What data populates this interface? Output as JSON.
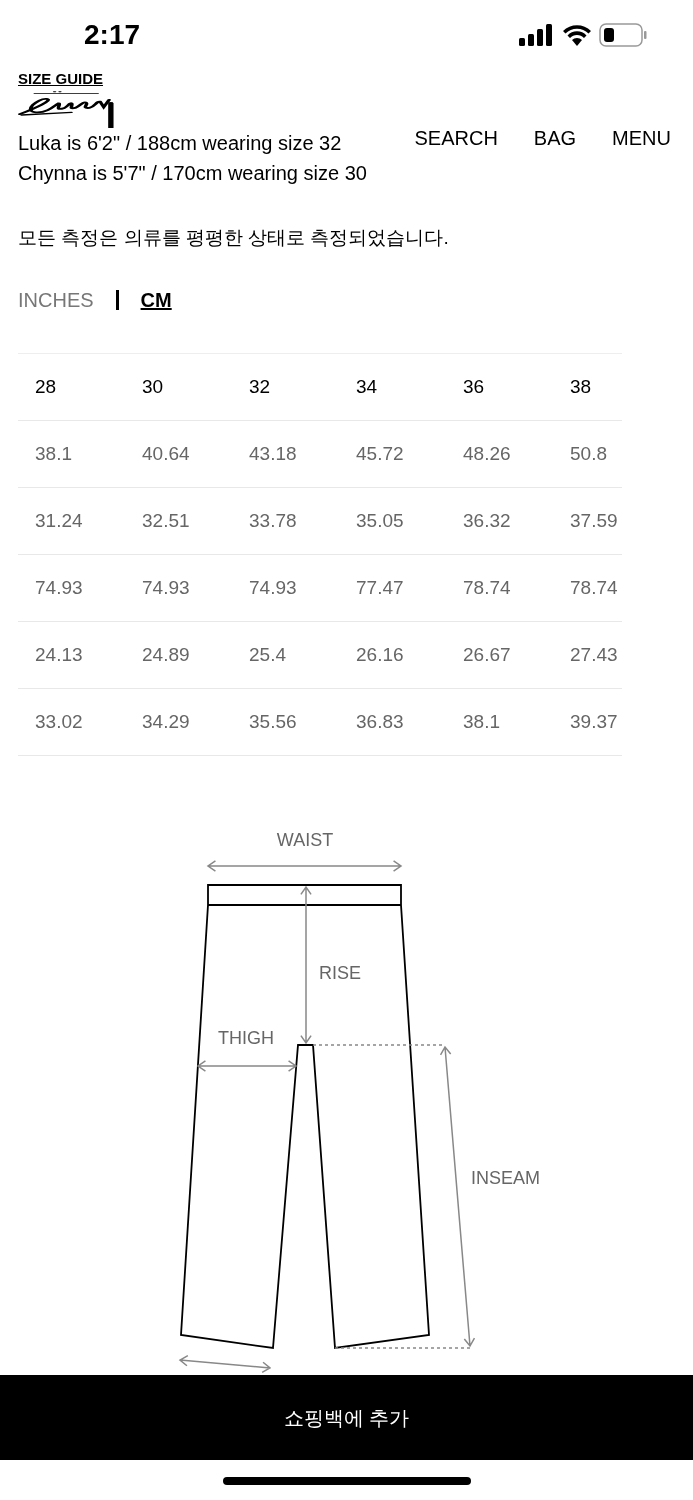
{
  "status_bar": {
    "time": "2:17"
  },
  "size_guide": {
    "label": "SIZE GUIDE"
  },
  "header": {
    "nav": [
      "SEARCH",
      "BAG",
      "MENU"
    ]
  },
  "model_notes": [
    "Luka is 6'2\" / 188cm wearing size 32",
    "Chynna is 5'7\" / 170cm wearing size 30"
  ],
  "note": "모든 측정은 의류를 평평한 상태로 측정되었습니다.",
  "units": [
    {
      "label": "INCHES",
      "selected": false
    },
    {
      "label": "CM",
      "selected": true
    }
  ],
  "table": {
    "columns": [
      "28",
      "30",
      "32",
      "34",
      "36",
      "38"
    ],
    "rows": [
      [
        "38.1",
        "40.64",
        "43.18",
        "45.72",
        "48.26",
        "50.8"
      ],
      [
        "31.24",
        "32.51",
        "33.78",
        "35.05",
        "36.32",
        "37.59"
      ],
      [
        "74.93",
        "74.93",
        "74.93",
        "77.47",
        "78.74",
        "78.74"
      ],
      [
        "24.13",
        "24.89",
        "25.4",
        "26.16",
        "26.67",
        "27.43"
      ],
      [
        "33.02",
        "34.29",
        "35.56",
        "36.83",
        "38.1",
        "39.37"
      ]
    ]
  },
  "diagram": {
    "labels": [
      "WAIST",
      "RISE",
      "THIGH",
      "INSEAM"
    ]
  },
  "add_to_bag_button": "쇼핑백에 추가"
}
